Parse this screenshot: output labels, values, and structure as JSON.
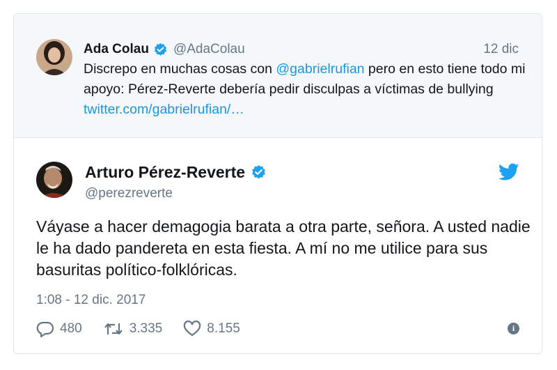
{
  "quoted_tweet": {
    "name": "Ada Colau",
    "handle": "@AdaColau",
    "date": "12 dic",
    "text_parts": {
      "p1": "Discrepo en muchas cosas con ",
      "mention": "@gabrielrufian",
      "p2": " pero en esto tiene todo mi apoyo: Pérez-Reverte debería pedir disculpas a víctimas de bullying ",
      "link": "twitter.com/gabrielrufian/…"
    }
  },
  "main_tweet": {
    "name": "Arturo Pérez-Reverte",
    "handle": "@perezreverte",
    "text": "Váyase a hacer demagogia barata a otra parte, señora. A usted nadie le ha dado pandereta en esta fiesta. A mí no me utilice para sus basuritas político-folklóricas.",
    "timestamp": "1:08 - 12 dic. 2017",
    "stats": {
      "replies": "480",
      "retweets": "3.335",
      "likes": "8.155"
    }
  },
  "colors": {
    "link": "#1b95e0",
    "verified": "#1da1f2",
    "muted": "#657786",
    "quoted_bg": "#f5f8fa"
  },
  "icons": [
    "verified-badge-icon",
    "twitter-bird-icon",
    "reply-icon",
    "retweet-icon",
    "like-icon",
    "info-icon"
  ]
}
